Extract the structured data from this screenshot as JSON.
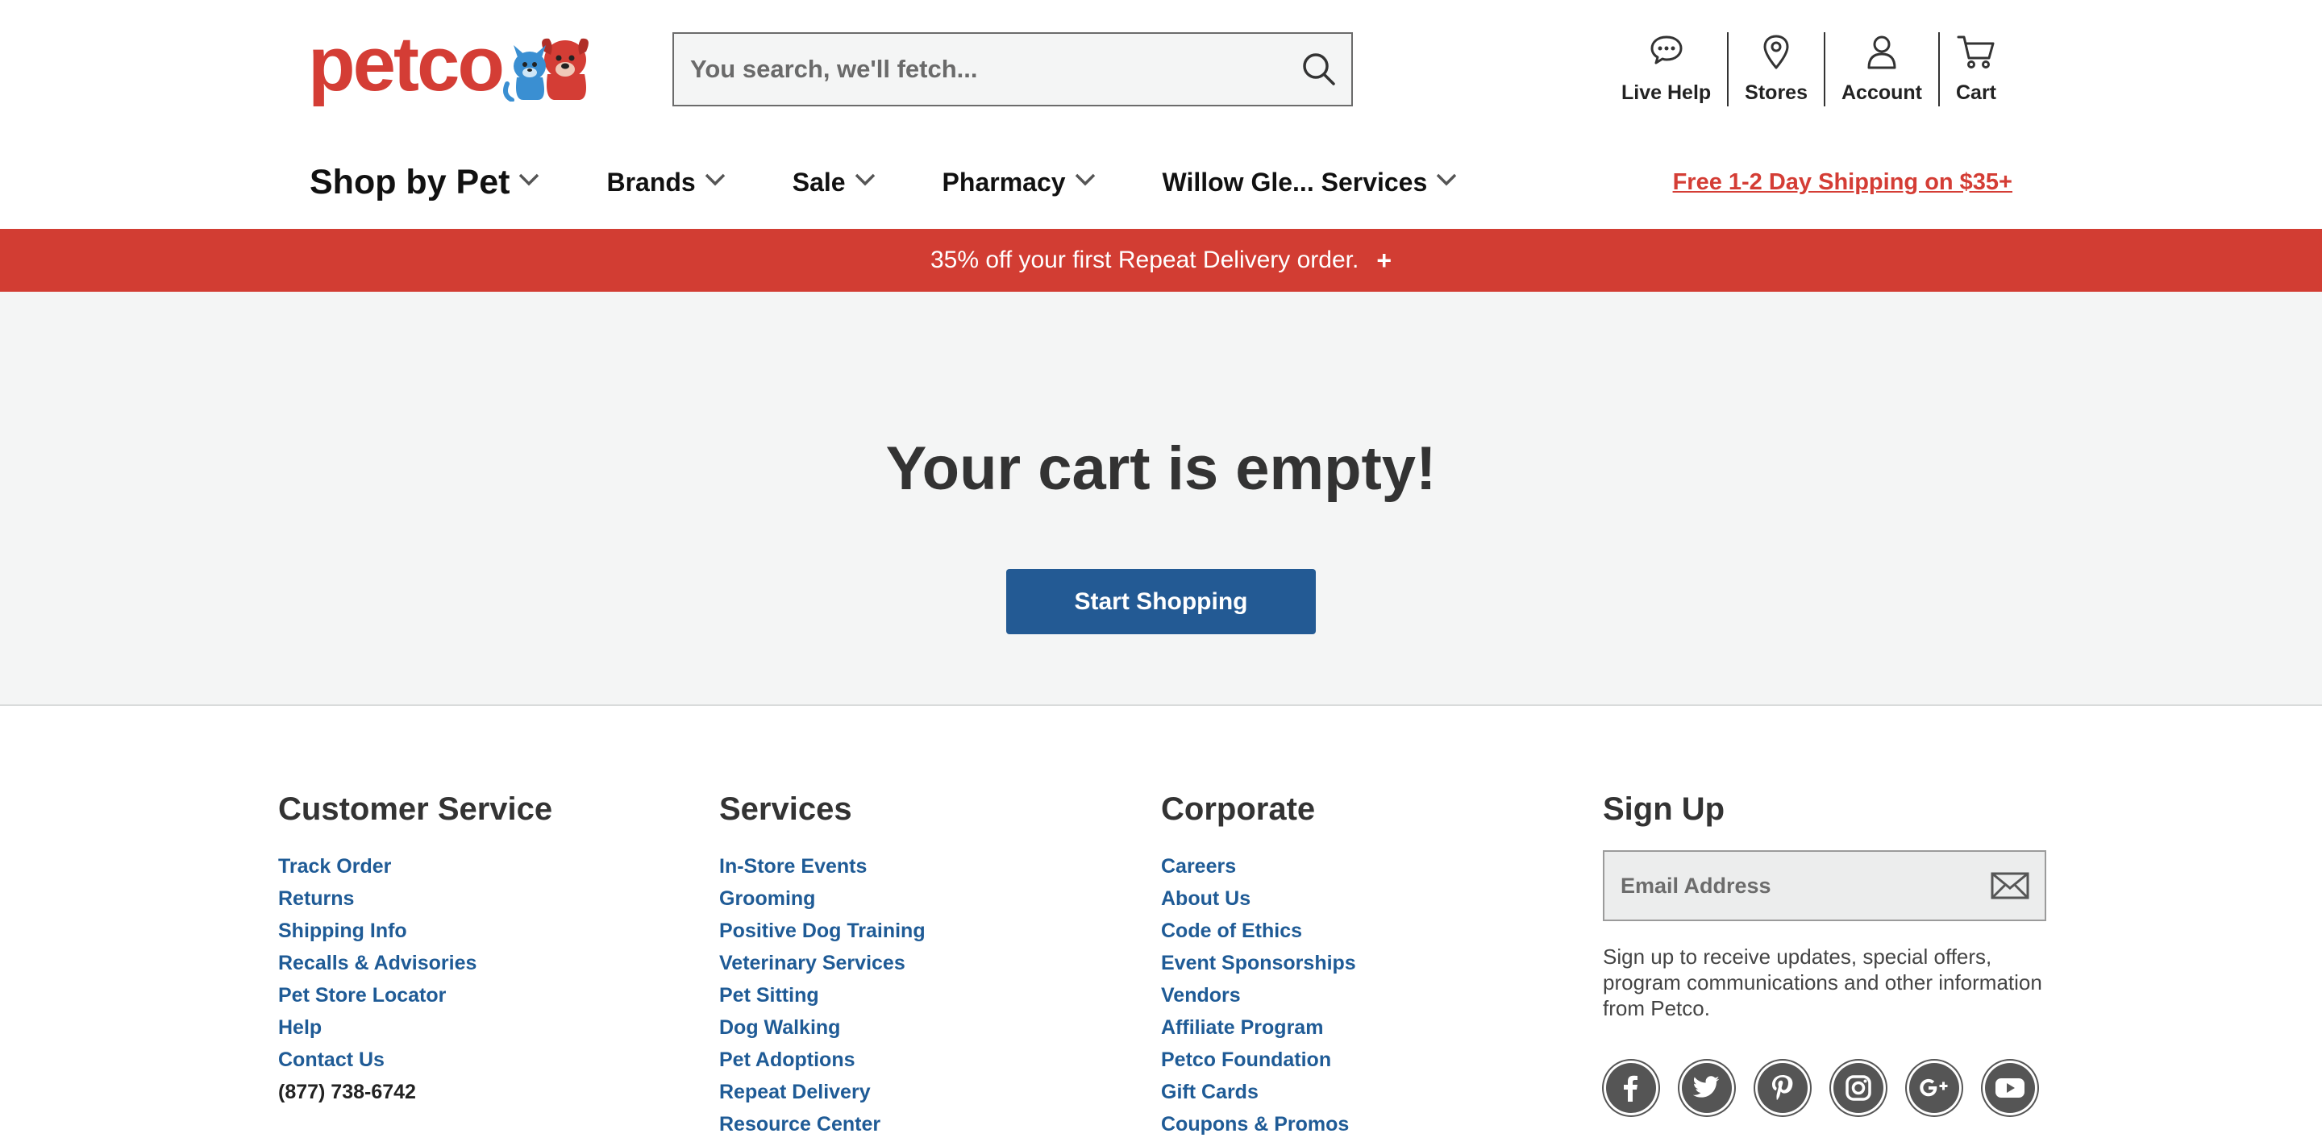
{
  "header": {
    "logo_text": "petco",
    "search": {
      "placeholder": "You search, we'll fetch..."
    },
    "utility": [
      {
        "label": "Live Help",
        "icon": "chat-bubble-icon"
      },
      {
        "label": "Stores",
        "icon": "map-pin-icon"
      },
      {
        "label": "Account",
        "icon": "user-icon"
      },
      {
        "label": "Cart",
        "icon": "cart-icon"
      }
    ]
  },
  "nav": {
    "items": [
      {
        "label": "Shop by Pet"
      },
      {
        "label": "Brands"
      },
      {
        "label": "Sale"
      },
      {
        "label": "Pharmacy"
      },
      {
        "label": "Willow Gle... Services"
      }
    ],
    "shipping_link": "Free 1-2 Day Shipping on $35+"
  },
  "promo": {
    "text": "35% off your first Repeat Delivery order.",
    "expand": "+"
  },
  "main": {
    "title": "Your cart is empty!",
    "button": "Start Shopping"
  },
  "footer": {
    "customer_service": {
      "heading": "Customer Service",
      "links": [
        "Track Order",
        "Returns",
        "Shipping Info",
        "Recalls & Advisories",
        "Pet Store Locator",
        "Help",
        "Contact Us"
      ],
      "phone": "(877) 738-6742"
    },
    "services": {
      "heading": "Services",
      "links": [
        "In-Store Events",
        "Grooming",
        "Positive Dog Training",
        "Veterinary Services",
        "Pet Sitting",
        "Dog Walking",
        "Pet Adoptions",
        "Repeat Delivery",
        "Resource Center"
      ]
    },
    "corporate": {
      "heading": "Corporate",
      "links": [
        "Careers",
        "About Us",
        "Code of Ethics",
        "Event Sponsorships",
        "Vendors",
        "Affiliate Program",
        "Petco Foundation",
        "Gift Cards",
        "Coupons & Promos"
      ]
    },
    "signup": {
      "heading": "Sign Up",
      "placeholder": "Email Address",
      "text": "Sign up to receive updates, special offers, program communications and other information from Petco.",
      "socials": [
        "facebook-icon",
        "twitter-icon",
        "pinterest-icon",
        "instagram-icon",
        "google-plus-icon",
        "youtube-icon"
      ]
    }
  },
  "colors": {
    "brand_red": "#d23d33",
    "link_blue": "#1f5b96",
    "button_blue": "#235a94",
    "main_bg": "#f4f5f5"
  }
}
